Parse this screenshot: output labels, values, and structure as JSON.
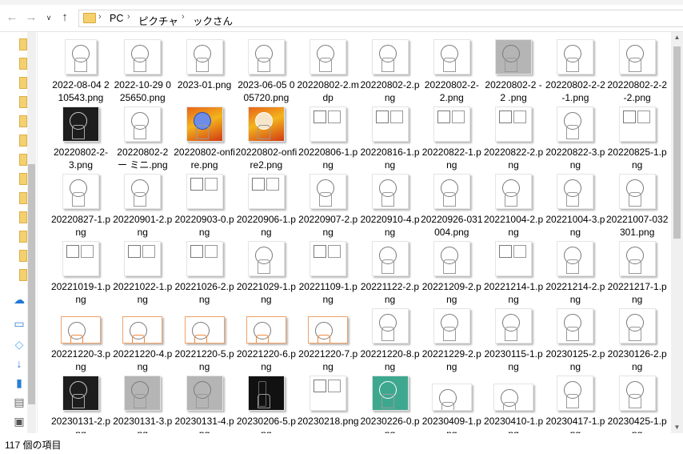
{
  "nav": {
    "back_icon": "back-arrow-icon",
    "forward_icon": "forward-arrow-icon",
    "recent_icon": "chevron-down-icon",
    "up_icon": "up-arrow-icon"
  },
  "address": {
    "separator": "›",
    "crumbs": [
      "PC",
      "ピクチャ",
      "ックさん"
    ]
  },
  "files": [
    {
      "name": "2022-08-04 210543.png",
      "style": "portrait"
    },
    {
      "name": "2022-10-29 025650.png",
      "style": "plain"
    },
    {
      "name": "2023-01.png",
      "style": "plain"
    },
    {
      "name": "2023-06-05 005720.png",
      "style": "plain"
    },
    {
      "name": "20220802-2.mdp",
      "style": "plain"
    },
    {
      "name": "20220802-2.png",
      "style": "plain"
    },
    {
      "name": "20220802-2-2.png",
      "style": "plain"
    },
    {
      "name": "20220802-2 - 2 .png",
      "style": "grey"
    },
    {
      "name": "20220802-2-2-1.png",
      "style": "plain"
    },
    {
      "name": "20220802-2-2-2.png",
      "style": "plain"
    },
    {
      "name": "20220802-2-3.png",
      "style": "dark"
    },
    {
      "name": "20220802-2 ー ミニ.png",
      "style": "plain"
    },
    {
      "name": "20220802-onfire.png",
      "style": "fire blue"
    },
    {
      "name": "20220802-onfire2.png",
      "style": "fire"
    },
    {
      "name": "20220806-1.png",
      "style": "panels"
    },
    {
      "name": "20220816-1.png",
      "style": "panels"
    },
    {
      "name": "20220822-1.png",
      "style": "panels"
    },
    {
      "name": "20220822-2.png",
      "style": "panels"
    },
    {
      "name": "20220822-3.png",
      "style": "plain"
    },
    {
      "name": "20220825-1.png",
      "style": "panels"
    },
    {
      "name": "20220827-1.png",
      "style": "plain"
    },
    {
      "name": "20220901-2.png",
      "style": "plain"
    },
    {
      "name": "20220903-0.png",
      "style": "panels"
    },
    {
      "name": "20220906-1.png",
      "style": "panels"
    },
    {
      "name": "20220907-2.png",
      "style": "plain"
    },
    {
      "name": "20220910-4.png",
      "style": "plain"
    },
    {
      "name": "20220926-031004.png",
      "style": "plain"
    },
    {
      "name": "20221004-2.png",
      "style": "plain"
    },
    {
      "name": "20221004-3.png",
      "style": "plain"
    },
    {
      "name": "20221007-032301.png",
      "style": "plain"
    },
    {
      "name": "20221019-1.png",
      "style": "panels"
    },
    {
      "name": "20221022-1.png",
      "style": "panels"
    },
    {
      "name": "20221026-2.png",
      "style": "panels"
    },
    {
      "name": "20221029-1.png",
      "style": "plain"
    },
    {
      "name": "20221109-1.png",
      "style": "panels"
    },
    {
      "name": "20221122-2.png",
      "style": "plain"
    },
    {
      "name": "20221209-2.png",
      "style": "plain"
    },
    {
      "name": "20221214-1.png",
      "style": "panels"
    },
    {
      "name": "20221214-2.png",
      "style": "plain"
    },
    {
      "name": "20221217-1.png",
      "style": "plain"
    },
    {
      "name": "20221220-3.png",
      "style": "landscape orange"
    },
    {
      "name": "20221220-4.png",
      "style": "landscape orange"
    },
    {
      "name": "20221220-5.png",
      "style": "landscape orange"
    },
    {
      "name": "20221220-6.png",
      "style": "landscape orange"
    },
    {
      "name": "20221220-7.png",
      "style": "landscape orange"
    },
    {
      "name": "20221220-8.png",
      "style": "plain"
    },
    {
      "name": "20221229-2.png",
      "style": "plain"
    },
    {
      "name": "20230115-1.png",
      "style": "plain"
    },
    {
      "name": "20230125-2.png",
      "style": "plain"
    },
    {
      "name": "20230126-2.png",
      "style": "plain"
    },
    {
      "name": "20230131-2.png",
      "style": "dark"
    },
    {
      "name": "20230131-3.png",
      "style": "grey"
    },
    {
      "name": "20230131-4.png",
      "style": "grey"
    },
    {
      "name": "20230206-5.png",
      "style": "black"
    },
    {
      "name": "20230218.png",
      "style": "panels"
    },
    {
      "name": "20230226-0.png",
      "style": "teal"
    },
    {
      "name": "20230409-1.png",
      "style": "landscape"
    },
    {
      "name": "20230410-1.png",
      "style": "landscape"
    },
    {
      "name": "20230417-1.png",
      "style": "plain"
    },
    {
      "name": "20230425-1.png",
      "style": "plain"
    }
  ],
  "status": {
    "item_count": "117 個の項目"
  }
}
